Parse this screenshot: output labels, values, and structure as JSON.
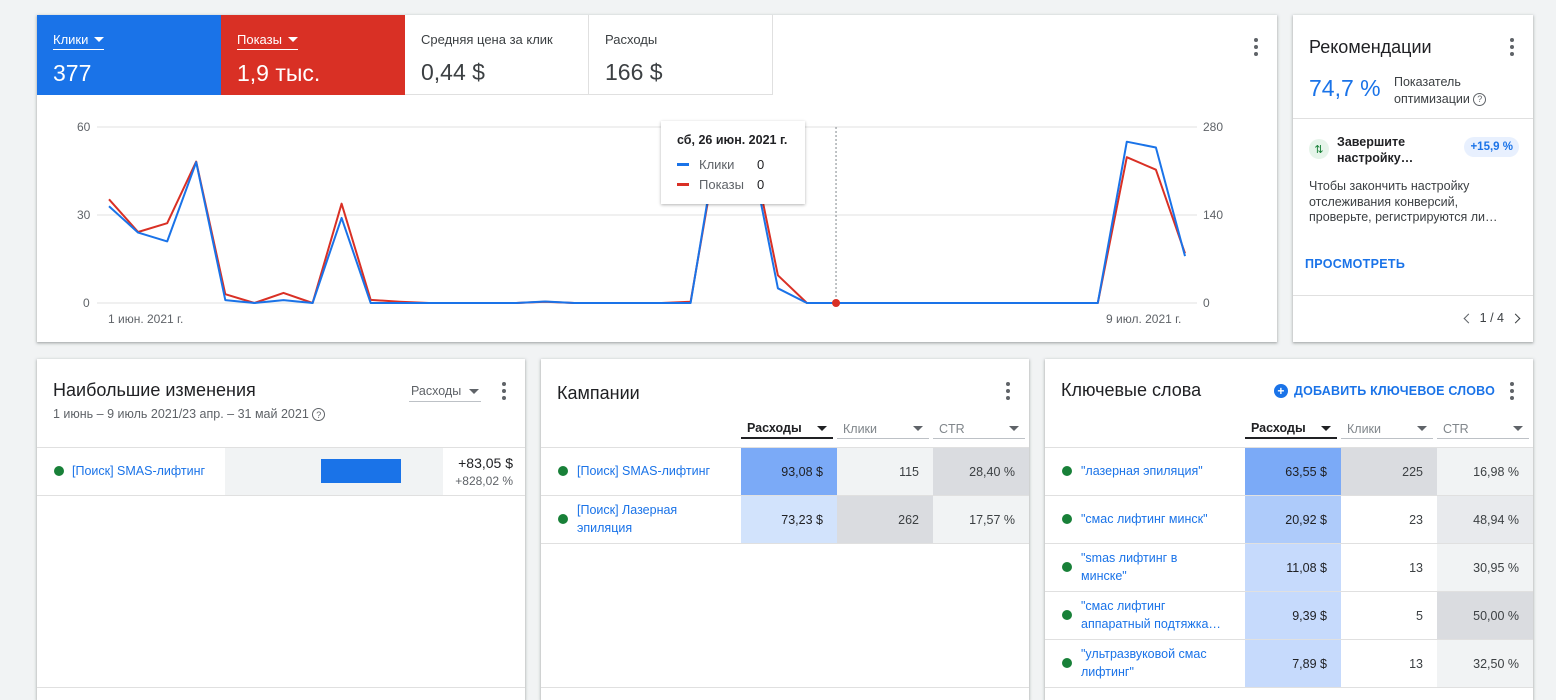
{
  "metrics": {
    "clicks": {
      "label": "Клики",
      "value": "377"
    },
    "impressions": {
      "label": "Показы",
      "value": "1,9 тыс."
    },
    "avg_cpc": {
      "label": "Средняя цена за клик",
      "value": "0,44 $"
    },
    "cost": {
      "label": "Расходы",
      "value": "166 $"
    }
  },
  "chart": {
    "left_ticks": [
      "60",
      "30",
      "0"
    ],
    "right_ticks": [
      "280",
      "140",
      "0"
    ],
    "x_start": "1 июн. 2021 г.",
    "x_end": "9 июл. 2021 г.",
    "tooltip": {
      "title": "сб, 26 июн. 2021 г.",
      "clicks_label": "Клики",
      "clicks_value": "0",
      "impr_label": "Показы",
      "impr_value": "0"
    }
  },
  "chart_data": {
    "type": "line",
    "x_labels": [
      "1 июн. 2021 г.",
      "9 июл. 2021 г."
    ],
    "left_axis": {
      "ylim": [
        0,
        60
      ],
      "ticks": [
        0,
        30,
        60
      ]
    },
    "right_axis": {
      "ylim": [
        0,
        280
      ],
      "ticks": [
        0,
        140,
        280
      ]
    },
    "series": [
      {
        "name": "Клики",
        "axis": "left",
        "color": "#1a73e8",
        "values": [
          33,
          24,
          21,
          48,
          1,
          0,
          1,
          0,
          29,
          0,
          0,
          0,
          0,
          0,
          0,
          0.5,
          0,
          0,
          0,
          0,
          0,
          60,
          55,
          5,
          0,
          0,
          0,
          0,
          0,
          0,
          0,
          0,
          0,
          0,
          0,
          55,
          53,
          16
        ]
      },
      {
        "name": "Показы",
        "axis": "right",
        "color": "#d93025",
        "values": [
          165,
          113,
          127,
          225,
          14,
          0,
          16,
          0,
          158,
          5,
          2,
          0,
          0,
          0,
          0,
          2,
          0,
          0,
          0,
          0,
          2,
          270,
          270,
          44,
          0,
          0,
          0,
          0,
          0,
          0,
          0,
          0,
          0,
          0,
          0,
          232,
          212,
          79
        ]
      }
    ],
    "highlight": {
      "label": "сб, 26 июн. 2021 г.",
      "clicks": 0,
      "impressions": 0
    }
  },
  "recommendations": {
    "title": "Рекомендации",
    "score": "74,7 %",
    "score_label_1": "Показатель",
    "score_label_2": "оптимизации",
    "item_title": "Завершите настройку…",
    "item_chip": "+15,9 %",
    "item_desc": "Чтобы закончить настройку отслеживания конверсий, проверьте, регистрируются ли…",
    "link": "ПРОСМОТРЕТЬ",
    "pager": "1 / 4"
  },
  "changes": {
    "title": "Наибольшие изменения",
    "metric_select": "Расходы",
    "period": "1 июнь – 9 июль 2021/23 апр. – 31 май 2021",
    "rows": [
      {
        "name": "[Поиск] SMAS-лифтинг",
        "delta": "+83,05 $",
        "pct": "+828,02 %",
        "bar_fraction": 0.5
      }
    ]
  },
  "campaigns": {
    "title": "Кампании",
    "cols": [
      "Расходы",
      "Клики",
      "CTR"
    ],
    "rows": [
      {
        "name_1": "[Поиск] SMAS-лифтинг",
        "name_2": "",
        "cost": "93,08 $",
        "clicks": "115",
        "ctr": "28,40 %"
      },
      {
        "name_1": "[Поиск] Лазерная",
        "name_2": "эпиляция",
        "cost": "73,23 $",
        "clicks": "262",
        "ctr": "17,57 %"
      }
    ]
  },
  "keywords": {
    "title": "Ключевые слова",
    "add": "ДОБАВИТЬ КЛЮЧЕВОЕ СЛОВО",
    "cols": [
      "Расходы",
      "Клики",
      "CTR"
    ],
    "rows": [
      {
        "name_1": "\"лазерная эпиляция\"",
        "name_2": "",
        "cost": "63,55 $",
        "clicks": "225",
        "ctr": "16,98 %"
      },
      {
        "name_1": "\"смас лифтинг минск\"",
        "name_2": "",
        "cost": "20,92 $",
        "clicks": "23",
        "ctr": "48,94 %"
      },
      {
        "name_1": "\"smas лифтинг в",
        "name_2": "минске\"",
        "cost": "11,08 $",
        "clicks": "13",
        "ctr": "30,95 %"
      },
      {
        "name_1": "\"смас лифтинг",
        "name_2": "аппаратный подтяжка…",
        "cost": "9,39 $",
        "clicks": "5",
        "ctr": "50,00 %"
      },
      {
        "name_1": "\"ультразвуковой смас",
        "name_2": "лифтинг\"",
        "cost": "7,89 $",
        "clicks": "13",
        "ctr": "32,50 %"
      }
    ]
  }
}
